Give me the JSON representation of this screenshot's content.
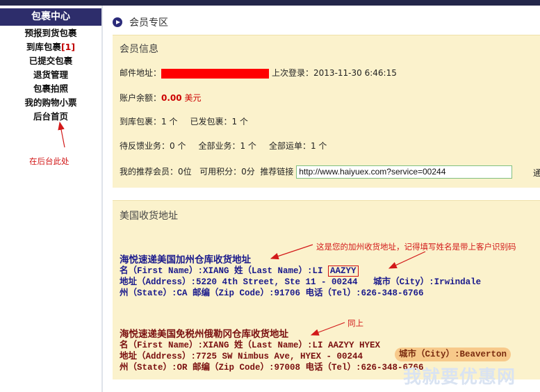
{
  "sidebar": {
    "title": "包裹中心",
    "items": [
      {
        "label": "预报到货包裹",
        "count": ""
      },
      {
        "label": "到库包裹",
        "count": "[1]"
      },
      {
        "label": "已提交包裹",
        "count": ""
      },
      {
        "label": "退货管理",
        "count": ""
      },
      {
        "label": "包裹拍照",
        "count": ""
      },
      {
        "label": "我的购物小票",
        "count": ""
      },
      {
        "label": "后台首页",
        "count": ""
      }
    ],
    "note": "在后台此处"
  },
  "main": {
    "heading": "会员专区",
    "member_info": {
      "title": "会员信息",
      "email_label": "邮件地址：",
      "last_login_label": "上次登录：",
      "last_login": "2013-11-30 6:46:15",
      "balance_label": "账户余额：",
      "balance": "0.00",
      "balance_unit": "美元",
      "arrived_label": "到库包裹：",
      "arrived_count": "1 个",
      "shipped_label": "已发包裹：",
      "shipped_count": "1 个",
      "pending_label": "待反馈业务：",
      "pending_count": "0 个",
      "all_business_label": "全部业务：",
      "all_business_count": "1 个",
      "all_waybill_label": "全部运单：",
      "all_waybill_count": "1 个",
      "referral_label": "我的推荐会员：",
      "referral_count": "0位",
      "points_label": "可用积分：",
      "points": "0分",
      "link_label": "推荐链接",
      "link_value": "http://www.haiyuex.com?service=00244",
      "edge_text": "通"
    },
    "us_address": {
      "title": "美国收货地址",
      "warehouse1": {
        "title": "海悦速递美国加州仓库收货地址",
        "line1a": "名（First Name）:XIANG   姓（Last Name）:LI ",
        "code": "AAZYY",
        "line2a": "地址（Address）:5220 4th Street, Ste 11 - 00244",
        "line2b": "城市（City）:Irwindale",
        "line3": "州（State）:CA   邮编（Zip Code）:91706  电话（Tel）:626-348-6766"
      },
      "warehouse2": {
        "title": "海悦速递美国免税州俄勒冈仓库收货地址",
        "line1": "名（First Name）:XIANG   姓（Last Name）:LI AAZYY HYEX",
        "line2": "地址（Address）:7725 SW Nimbus Ave, HYEX - 00244",
        "line3": "州（State）:OR   邮编（Zip Code）:97008   电话（Tel）:626-348-6766",
        "city": "城市（City）:Beaverton"
      }
    },
    "annotations": {
      "note1": "这是您的加州收货地址，记得填写姓名是带上客户识别码",
      "note2": "同上"
    }
  },
  "watermark": "我就要优惠网",
  "colors": {
    "sidebar_header": "#2d2d6b",
    "panel_bg": "#fbf2cc",
    "annotation": "#d21919",
    "address_blue": "#1a1a8c",
    "address_maroon": "#7a0f0f"
  }
}
